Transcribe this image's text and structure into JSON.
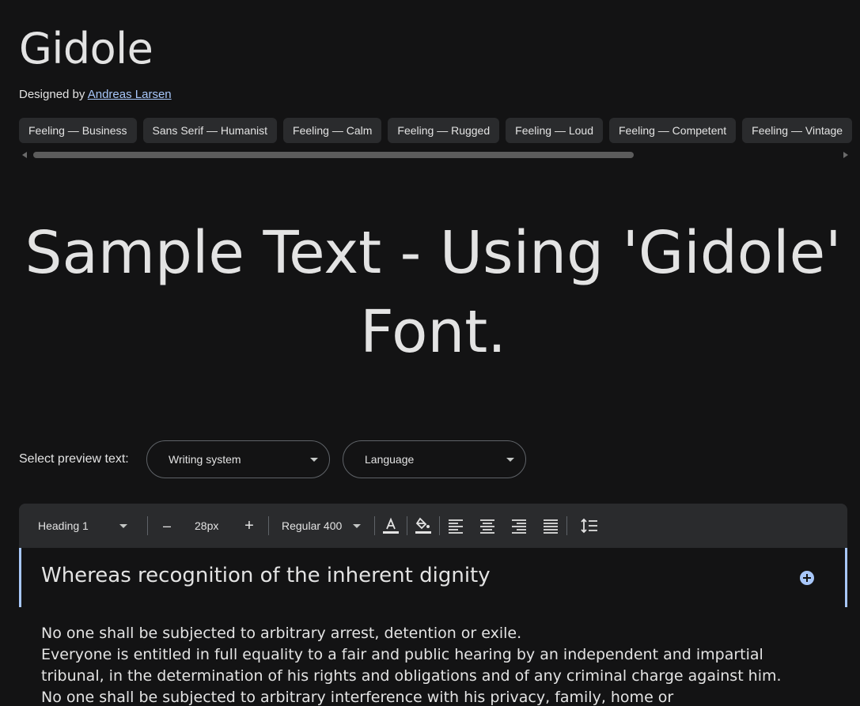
{
  "font": {
    "name": "Gidole",
    "designed_by_label": "Designed by",
    "designer": "Andreas Larsen"
  },
  "tags": [
    "Feeling — Business",
    "Sans Serif — Humanist",
    "Feeling — Calm",
    "Feeling — Rugged",
    "Feeling — Loud",
    "Feeling — Competent",
    "Feeling — Vintage"
  ],
  "sample_text": "Sample Text - Using 'Gidole' Font.",
  "preview": {
    "label": "Select preview text:",
    "writing_system": "Writing system",
    "language": "Language"
  },
  "toolbar": {
    "style": "Heading 1",
    "decrease": "–",
    "size": "28px",
    "increase": "+",
    "weight": "Regular 400"
  },
  "editor": {
    "heading": "Whereas recognition of the inherent dignity",
    "paragraphs": [
      "No one shall be subjected to arbitrary arrest, detention or exile.",
      "Everyone is entitled in full equality to a fair and public hearing by an independent and impartial",
      "tribunal, in the determination of his rights and obligations and of any criminal charge against him.",
      "No one shall be subjected to arbitrary interference with his privacy, family, home or"
    ]
  },
  "colors": {
    "background": "#131314",
    "surface": "#2a2b2d",
    "accent": "#a8c7fa",
    "text": "#e3e3e3"
  }
}
